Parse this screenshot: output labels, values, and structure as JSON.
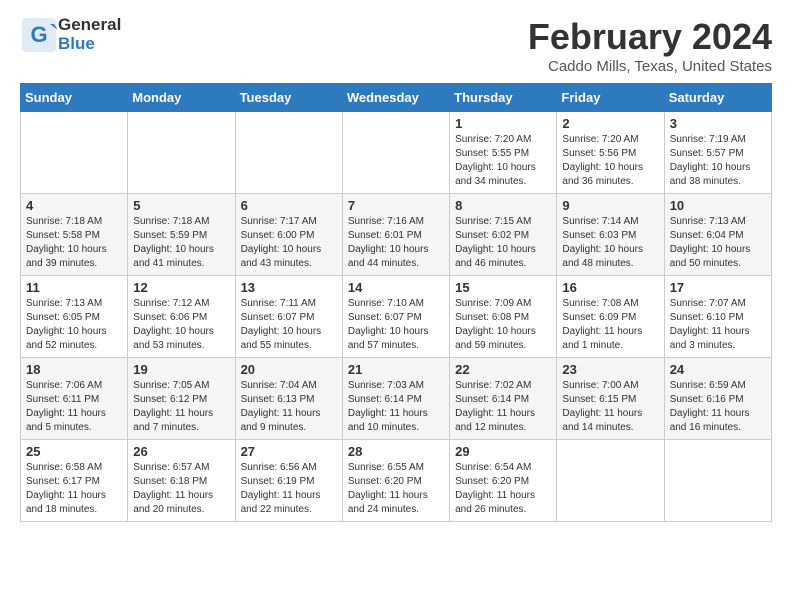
{
  "header": {
    "logo_general": "General",
    "logo_blue": "Blue",
    "month": "February 2024",
    "location": "Caddo Mills, Texas, United States"
  },
  "weekdays": [
    "Sunday",
    "Monday",
    "Tuesday",
    "Wednesday",
    "Thursday",
    "Friday",
    "Saturday"
  ],
  "weeks": [
    [
      {
        "day": "",
        "info": ""
      },
      {
        "day": "",
        "info": ""
      },
      {
        "day": "",
        "info": ""
      },
      {
        "day": "",
        "info": ""
      },
      {
        "day": "1",
        "info": "Sunrise: 7:20 AM\nSunset: 5:55 PM\nDaylight: 10 hours\nand 34 minutes."
      },
      {
        "day": "2",
        "info": "Sunrise: 7:20 AM\nSunset: 5:56 PM\nDaylight: 10 hours\nand 36 minutes."
      },
      {
        "day": "3",
        "info": "Sunrise: 7:19 AM\nSunset: 5:57 PM\nDaylight: 10 hours\nand 38 minutes."
      }
    ],
    [
      {
        "day": "4",
        "info": "Sunrise: 7:18 AM\nSunset: 5:58 PM\nDaylight: 10 hours\nand 39 minutes."
      },
      {
        "day": "5",
        "info": "Sunrise: 7:18 AM\nSunset: 5:59 PM\nDaylight: 10 hours\nand 41 minutes."
      },
      {
        "day": "6",
        "info": "Sunrise: 7:17 AM\nSunset: 6:00 PM\nDaylight: 10 hours\nand 43 minutes."
      },
      {
        "day": "7",
        "info": "Sunrise: 7:16 AM\nSunset: 6:01 PM\nDaylight: 10 hours\nand 44 minutes."
      },
      {
        "day": "8",
        "info": "Sunrise: 7:15 AM\nSunset: 6:02 PM\nDaylight: 10 hours\nand 46 minutes."
      },
      {
        "day": "9",
        "info": "Sunrise: 7:14 AM\nSunset: 6:03 PM\nDaylight: 10 hours\nand 48 minutes."
      },
      {
        "day": "10",
        "info": "Sunrise: 7:13 AM\nSunset: 6:04 PM\nDaylight: 10 hours\nand 50 minutes."
      }
    ],
    [
      {
        "day": "11",
        "info": "Sunrise: 7:13 AM\nSunset: 6:05 PM\nDaylight: 10 hours\nand 52 minutes."
      },
      {
        "day": "12",
        "info": "Sunrise: 7:12 AM\nSunset: 6:06 PM\nDaylight: 10 hours\nand 53 minutes."
      },
      {
        "day": "13",
        "info": "Sunrise: 7:11 AM\nSunset: 6:07 PM\nDaylight: 10 hours\nand 55 minutes."
      },
      {
        "day": "14",
        "info": "Sunrise: 7:10 AM\nSunset: 6:07 PM\nDaylight: 10 hours\nand 57 minutes."
      },
      {
        "day": "15",
        "info": "Sunrise: 7:09 AM\nSunset: 6:08 PM\nDaylight: 10 hours\nand 59 minutes."
      },
      {
        "day": "16",
        "info": "Sunrise: 7:08 AM\nSunset: 6:09 PM\nDaylight: 11 hours\nand 1 minute."
      },
      {
        "day": "17",
        "info": "Sunrise: 7:07 AM\nSunset: 6:10 PM\nDaylight: 11 hours\nand 3 minutes."
      }
    ],
    [
      {
        "day": "18",
        "info": "Sunrise: 7:06 AM\nSunset: 6:11 PM\nDaylight: 11 hours\nand 5 minutes."
      },
      {
        "day": "19",
        "info": "Sunrise: 7:05 AM\nSunset: 6:12 PM\nDaylight: 11 hours\nand 7 minutes."
      },
      {
        "day": "20",
        "info": "Sunrise: 7:04 AM\nSunset: 6:13 PM\nDaylight: 11 hours\nand 9 minutes."
      },
      {
        "day": "21",
        "info": "Sunrise: 7:03 AM\nSunset: 6:14 PM\nDaylight: 11 hours\nand 10 minutes."
      },
      {
        "day": "22",
        "info": "Sunrise: 7:02 AM\nSunset: 6:14 PM\nDaylight: 11 hours\nand 12 minutes."
      },
      {
        "day": "23",
        "info": "Sunrise: 7:00 AM\nSunset: 6:15 PM\nDaylight: 11 hours\nand 14 minutes."
      },
      {
        "day": "24",
        "info": "Sunrise: 6:59 AM\nSunset: 6:16 PM\nDaylight: 11 hours\nand 16 minutes."
      }
    ],
    [
      {
        "day": "25",
        "info": "Sunrise: 6:58 AM\nSunset: 6:17 PM\nDaylight: 11 hours\nand 18 minutes."
      },
      {
        "day": "26",
        "info": "Sunrise: 6:57 AM\nSunset: 6:18 PM\nDaylight: 11 hours\nand 20 minutes."
      },
      {
        "day": "27",
        "info": "Sunrise: 6:56 AM\nSunset: 6:19 PM\nDaylight: 11 hours\nand 22 minutes."
      },
      {
        "day": "28",
        "info": "Sunrise: 6:55 AM\nSunset: 6:20 PM\nDaylight: 11 hours\nand 24 minutes."
      },
      {
        "day": "29",
        "info": "Sunrise: 6:54 AM\nSunset: 6:20 PM\nDaylight: 11 hours\nand 26 minutes."
      },
      {
        "day": "",
        "info": ""
      },
      {
        "day": "",
        "info": ""
      }
    ]
  ]
}
